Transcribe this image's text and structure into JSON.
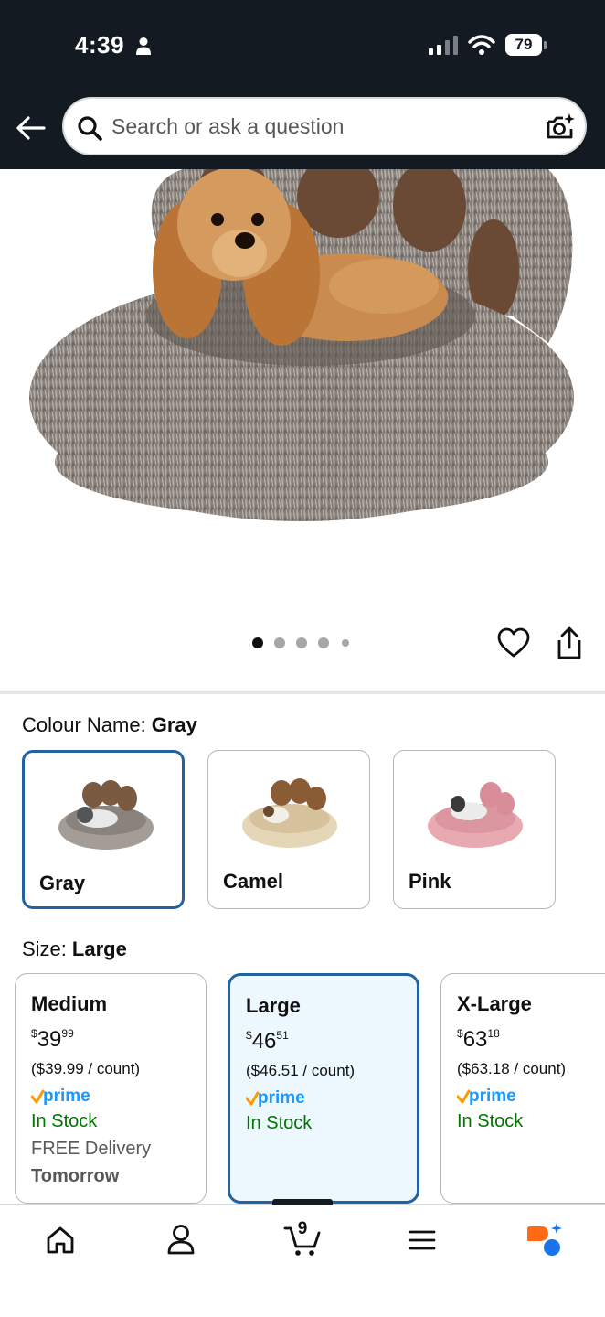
{
  "status_bar": {
    "time": "4:39",
    "battery": "79"
  },
  "header": {
    "search_placeholder": "Search or ask a question"
  },
  "product": {
    "image_count": 5,
    "active_image_index": 0
  },
  "colour": {
    "label": "Colour Name:",
    "selected": "Gray",
    "options": [
      {
        "name": "Gray",
        "swatch_color": "#a39c97",
        "selected": true
      },
      {
        "name": "Camel",
        "swatch_color": "#e6d6b8",
        "selected": false
      },
      {
        "name": "Pink",
        "swatch_color": "#e8a9b2",
        "selected": false
      }
    ]
  },
  "size": {
    "label": "Size:",
    "selected": "Large",
    "options": [
      {
        "name": "Medium",
        "price_symbol": "$",
        "price_whole": "39",
        "price_fraction": "99",
        "unit_price": "($39.99 / count)",
        "prime": true,
        "stock": "In Stock",
        "delivery": "FREE Delivery",
        "delivery_day": "Tomorrow",
        "selected": false
      },
      {
        "name": "Large",
        "price_symbol": "$",
        "price_whole": "46",
        "price_fraction": "51",
        "unit_price": "($46.51 / count)",
        "prime": true,
        "stock": "In Stock",
        "selected": true
      },
      {
        "name": "X-Large",
        "price_symbol": "$",
        "price_whole": "63",
        "price_fraction": "18",
        "unit_price": "($63.18 / count)",
        "prime": true,
        "stock": "In Stock",
        "selected": false
      }
    ]
  },
  "bottom_nav": {
    "cart_count": "9",
    "items": [
      "home-icon",
      "account-icon",
      "cart-icon",
      "menu-icon",
      "rufus-icon"
    ]
  },
  "colors": {
    "header_bg": "#131a22",
    "selected_border": "#2162a1",
    "selected_card_bg": "#edf7fe",
    "in_stock": "#007600",
    "prime_blue": "#1a98ff",
    "prime_check": "#ff9900"
  }
}
